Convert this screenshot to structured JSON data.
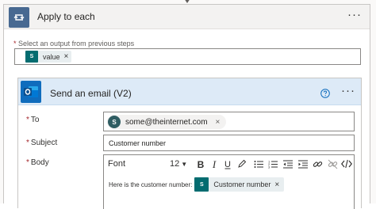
{
  "apply_to_each": {
    "title": "Apply to each",
    "more_label": "···",
    "select_label": "Select an output from previous steps",
    "required_mark": "*",
    "token": {
      "label": "value",
      "remove": "×",
      "badge": "S"
    }
  },
  "send_email": {
    "title": "Send an email (V2)",
    "more_label": "···",
    "fields": {
      "to": {
        "label": "To",
        "recipient": "some@theinternet.com",
        "avatar_initial": "S",
        "remove": "×"
      },
      "subject": {
        "label": "Subject",
        "value": "Customer number"
      },
      "body": {
        "label": "Body",
        "toolbar": {
          "font": "Font",
          "font_size": "12",
          "buttons": [
            "bold",
            "italic",
            "underline",
            "pen",
            "bulleted-list",
            "numbered-list",
            "decrease-indent",
            "increase-indent",
            "link",
            "unlink",
            "code-view"
          ]
        },
        "text": "Here is the customer number:",
        "token": {
          "label": "Customer number",
          "remove": "×",
          "badge": "S"
        }
      }
    }
  },
  "colors": {
    "loop_tile": "#486991",
    "outlook_tile": "#0f6cbd",
    "email_header_bg": "#ddeaf7",
    "sharepoint_badge": "#036c70",
    "required": "#a4262c"
  }
}
